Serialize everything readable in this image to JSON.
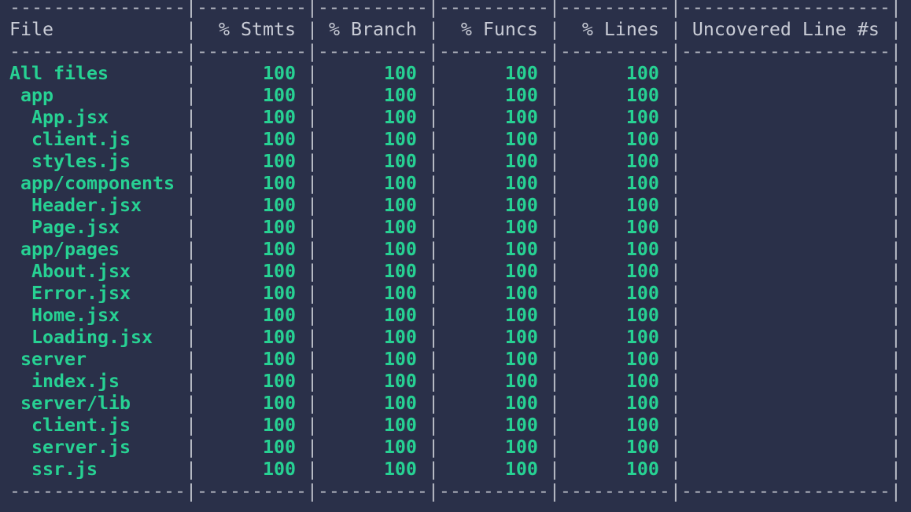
{
  "colors": {
    "background": "#2a3049",
    "text": "#c9ccd6",
    "covered": "#27d193"
  },
  "header": {
    "file": "File",
    "stmts": "% Stmts",
    "branch": "% Branch",
    "funcs": "% Funcs",
    "lines": "% Lines",
    "uncovered": "Uncovered Line #s"
  },
  "rows": [
    {
      "file": "All files",
      "indent": 0,
      "stmts": "100",
      "branch": "100",
      "funcs": "100",
      "lines": "100",
      "uncovered": ""
    },
    {
      "file": "app",
      "indent": 1,
      "stmts": "100",
      "branch": "100",
      "funcs": "100",
      "lines": "100",
      "uncovered": ""
    },
    {
      "file": "App.jsx",
      "indent": 2,
      "stmts": "100",
      "branch": "100",
      "funcs": "100",
      "lines": "100",
      "uncovered": ""
    },
    {
      "file": "client.js",
      "indent": 2,
      "stmts": "100",
      "branch": "100",
      "funcs": "100",
      "lines": "100",
      "uncovered": ""
    },
    {
      "file": "styles.js",
      "indent": 2,
      "stmts": "100",
      "branch": "100",
      "funcs": "100",
      "lines": "100",
      "uncovered": ""
    },
    {
      "file": "app/components",
      "indent": 1,
      "stmts": "100",
      "branch": "100",
      "funcs": "100",
      "lines": "100",
      "uncovered": ""
    },
    {
      "file": "Header.jsx",
      "indent": 2,
      "stmts": "100",
      "branch": "100",
      "funcs": "100",
      "lines": "100",
      "uncovered": ""
    },
    {
      "file": "Page.jsx",
      "indent": 2,
      "stmts": "100",
      "branch": "100",
      "funcs": "100",
      "lines": "100",
      "uncovered": ""
    },
    {
      "file": "app/pages",
      "indent": 1,
      "stmts": "100",
      "branch": "100",
      "funcs": "100",
      "lines": "100",
      "uncovered": ""
    },
    {
      "file": "About.jsx",
      "indent": 2,
      "stmts": "100",
      "branch": "100",
      "funcs": "100",
      "lines": "100",
      "uncovered": ""
    },
    {
      "file": "Error.jsx",
      "indent": 2,
      "stmts": "100",
      "branch": "100",
      "funcs": "100",
      "lines": "100",
      "uncovered": ""
    },
    {
      "file": "Home.jsx",
      "indent": 2,
      "stmts": "100",
      "branch": "100",
      "funcs": "100",
      "lines": "100",
      "uncovered": ""
    },
    {
      "file": "Loading.jsx",
      "indent": 2,
      "stmts": "100",
      "branch": "100",
      "funcs": "100",
      "lines": "100",
      "uncovered": ""
    },
    {
      "file": "server",
      "indent": 1,
      "stmts": "100",
      "branch": "100",
      "funcs": "100",
      "lines": "100",
      "uncovered": ""
    },
    {
      "file": "index.js",
      "indent": 2,
      "stmts": "100",
      "branch": "100",
      "funcs": "100",
      "lines": "100",
      "uncovered": ""
    },
    {
      "file": "server/lib",
      "indent": 1,
      "stmts": "100",
      "branch": "100",
      "funcs": "100",
      "lines": "100",
      "uncovered": ""
    },
    {
      "file": "client.js",
      "indent": 2,
      "stmts": "100",
      "branch": "100",
      "funcs": "100",
      "lines": "100",
      "uncovered": ""
    },
    {
      "file": "server.js",
      "indent": 2,
      "stmts": "100",
      "branch": "100",
      "funcs": "100",
      "lines": "100",
      "uncovered": ""
    },
    {
      "file": "ssr.js",
      "indent": 2,
      "stmts": "100",
      "branch": "100",
      "funcs": "100",
      "lines": "100",
      "uncovered": ""
    }
  ]
}
